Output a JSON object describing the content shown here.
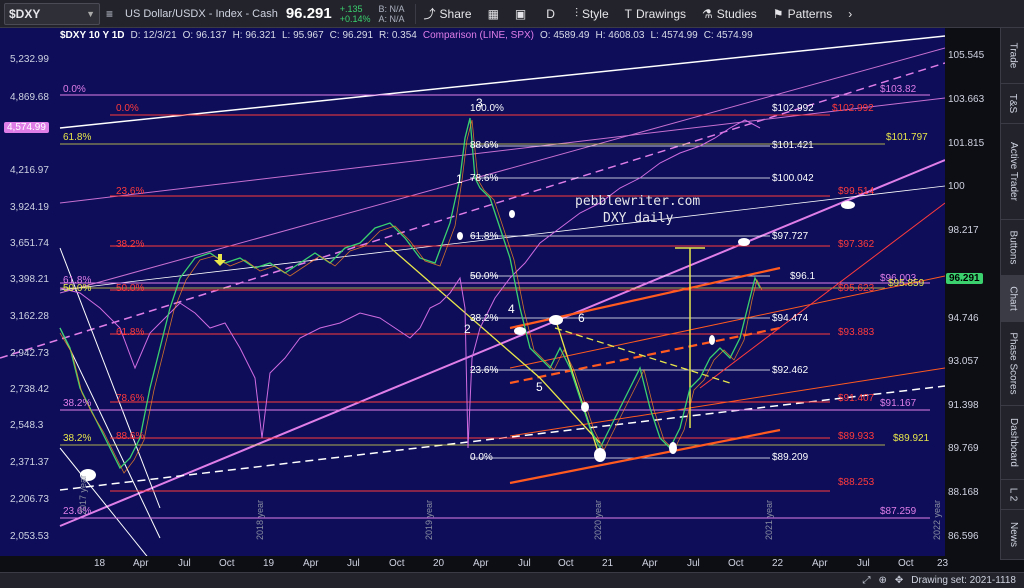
{
  "toolbar": {
    "symbol": "$DXY",
    "instrument_name": "US Dollar/USDX - Index - Cash",
    "last_price": "96.291",
    "change": "+.135",
    "change_pct": "+0.14%",
    "bid": "B: N/A",
    "ask": "A: N/A",
    "share_label": "Share",
    "period": "D",
    "style_label": "Style",
    "drawings_label": "Drawings",
    "studies_label": "Studies",
    "patterns_label": "Patterns"
  },
  "legend": {
    "symbol": "$DXY 10 Y 1D",
    "date": "D: 12/3/21",
    "open": "O: 96.137",
    "high": "H: 96.321",
    "low": "L: 95.967",
    "close": "C: 96.291",
    "range": "R: 0.354",
    "comparison": "Comparison (LINE, SPX)",
    "cmp_open": "O: 4589.49",
    "cmp_high": "H: 4608.03",
    "cmp_low": "L: 4574.99",
    "cmp_close": "C: 4574.99"
  },
  "left_axis": [
    "5,232.99",
    "4,869.68",
    "4,574.99",
    "4,216.97",
    "3,924.19",
    "3,651.74",
    "3,398.21",
    "3,162.28",
    "2,942.73",
    "2,738.42",
    "2,548.3",
    "2,371.37",
    "2,206.73",
    "2,053.53"
  ],
  "right_axis": [
    "105.545",
    "103.663",
    "101.815",
    "100",
    "98.217",
    "96.291",
    "94.746",
    "93.057",
    "91.398",
    "89.769",
    "88.168",
    "86.596"
  ],
  "x_axis": [
    "18",
    "Apr",
    "Jul",
    "Oct",
    "19",
    "Apr",
    "Jul",
    "Oct",
    "20",
    "Apr",
    "Jul",
    "Oct",
    "21",
    "Apr",
    "Jul",
    "Oct",
    "22",
    "Apr",
    "Jul",
    "Oct",
    "23"
  ],
  "year_markers": [
    "2017 year",
    "2018 year",
    "2019 year",
    "2020 year",
    "2021 year",
    "2022 year"
  ],
  "fib_white": [
    "100.0%",
    "88.6%",
    "78.6%",
    "61.8%",
    "50.0%",
    "38.2%",
    "23.6%",
    "0.0%"
  ],
  "fib_white_values": [
    "$102.992",
    "$101.421",
    "$100.042",
    "$97.727",
    "$96.1",
    "$94.474",
    "$92.462",
    "$89.209"
  ],
  "fib_red": [
    "0.0%",
    "23.6%",
    "38.2%",
    "50.0%",
    "61.8%",
    "78.6%",
    "88.6%"
  ],
  "fib_red_values": [
    "$102.992",
    "$99.514",
    "$97.362",
    "$95.623",
    "$93.883",
    "$91.407",
    "$89.933",
    "$88.253"
  ],
  "fib_magenta": [
    "0.0%",
    "61.8%",
    "50.0%",
    "38.2%",
    "23.6%"
  ],
  "fib_magenta_values": [
    "$103.82",
    "$96.003",
    "$91.167",
    "$87.259"
  ],
  "fib_yellow_values": [
    "$101.797",
    "$95.859",
    "$89.921"
  ],
  "wave_labels": [
    "1",
    "2",
    "3",
    "4",
    "5",
    "6"
  ],
  "watermark_line1": "pebblewriter.com",
  "watermark_line2": "DXY daily",
  "price_tags": {
    "spx": "4,574.99",
    "dxy": "96.291"
  },
  "side_tabs": [
    "Trade",
    "T&S",
    "Active Trader",
    "Buttons",
    "Chart",
    "Phase Scores",
    "Dashboard",
    "L 2",
    "News"
  ],
  "status": {
    "drawing_set": "Drawing set: 2021-1118"
  },
  "colors": {
    "chart_bg": "#0d0d5a",
    "white_fib": "#ffffff",
    "red_fib": "#ff3b3b",
    "magenta": "#e07ee8",
    "yellow": "#e8e64a",
    "candle_up": "#3bd16f",
    "candle_down": "#ff8a1f"
  }
}
